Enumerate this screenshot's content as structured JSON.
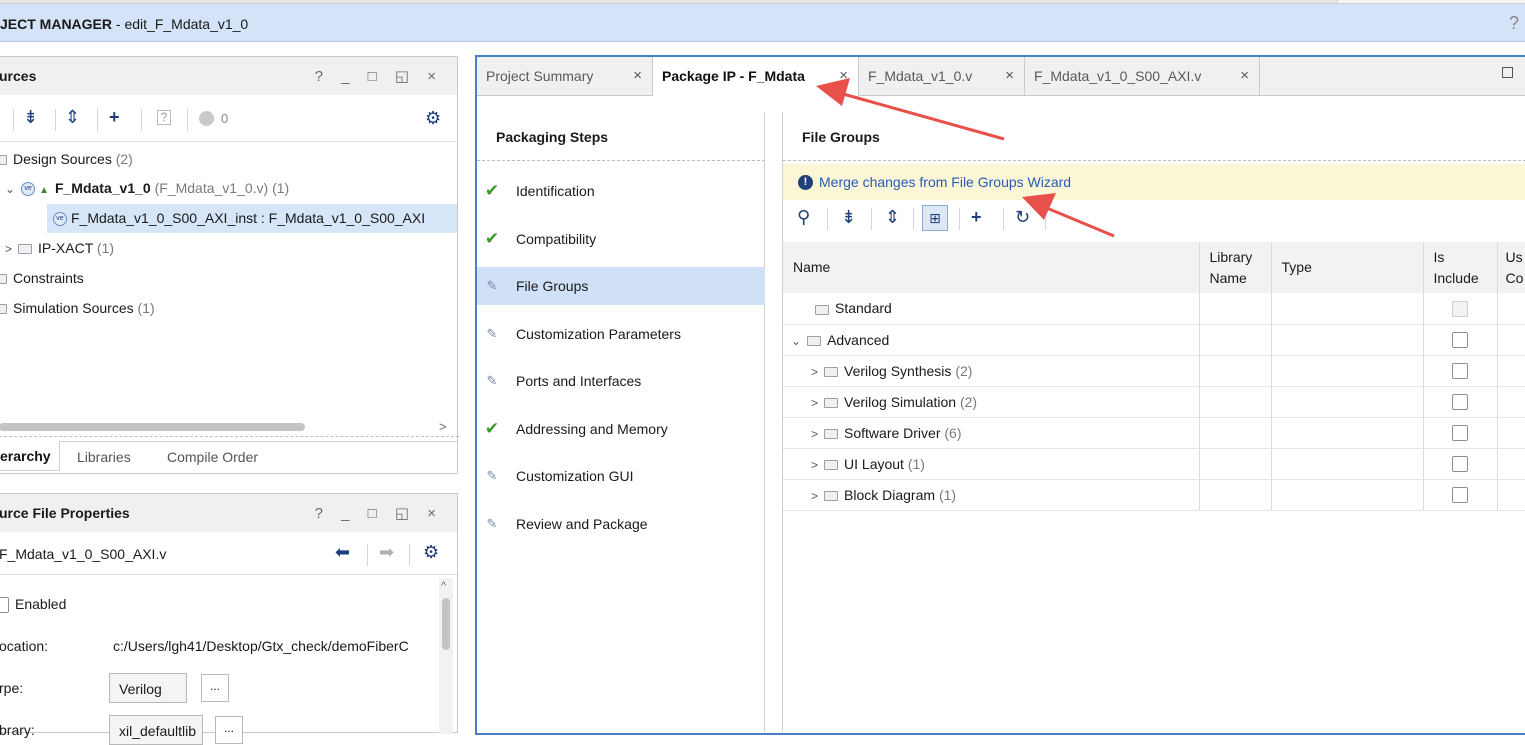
{
  "header": {
    "title_bold": "JECT MANAGER",
    "title_rest": " - edit_F_Mdata_v1_0",
    "help": "?"
  },
  "sources_panel": {
    "title": "urces",
    "controls": "? _ □ ◱ ×",
    "badge_count": "0",
    "tree": [
      {
        "label": "Design Sources",
        "count": "(2)"
      },
      {
        "label": "F_Mdata_v1_0",
        "detail": "(F_Mdata_v1_0.v)",
        "count": "(1)"
      },
      {
        "label": "F_Mdata_v1_0_S00_AXI_inst : F_Mdata_v1_0_S00_AXI"
      },
      {
        "label": "IP-XACT",
        "count": "(1)"
      },
      {
        "label": "Constraints"
      },
      {
        "label": "Simulation Sources",
        "count": "(1)"
      }
    ],
    "tabs": [
      "erarchy",
      "Libraries",
      "Compile Order"
    ]
  },
  "properties_panel": {
    "title": "urce File Properties",
    "controls": "? _ □ ◱ ×",
    "file_name": "F_Mdata_v1_0_S00_AXI.v",
    "enabled_label": "Enabled",
    "location_label": "ocation:",
    "location_value": "c:/Users/lgh41/Desktop/Gtx_check/demoFiberC",
    "type_label": "rpe:",
    "type_value": "Verilog",
    "library_label": "brary:",
    "library_value": "xil_defaultlib",
    "dots": "..."
  },
  "main_tabs": [
    {
      "label": "Project Summary"
    },
    {
      "label": "Package IP - F_Mdata"
    },
    {
      "label": "F_Mdata_v1_0.v"
    },
    {
      "label": "F_Mdata_v1_0_S00_AXI.v"
    }
  ],
  "packaging": {
    "title": "Packaging Steps",
    "steps": [
      {
        "label": "Identification",
        "status": "done"
      },
      {
        "label": "Compatibility",
        "status": "done"
      },
      {
        "label": "File Groups",
        "status": "edit"
      },
      {
        "label": "Customization Parameters",
        "status": "edit"
      },
      {
        "label": "Ports and Interfaces",
        "status": "edit"
      },
      {
        "label": "Addressing and Memory",
        "status": "done"
      },
      {
        "label": "Customization GUI",
        "status": "edit"
      },
      {
        "label": "Review and Package",
        "status": "edit"
      }
    ]
  },
  "file_groups": {
    "title": "File Groups",
    "banner_link": "Merge changes from File Groups Wizard",
    "columns": {
      "name": "Name",
      "library_1": "Library",
      "library_2": "Name",
      "type": "Type",
      "include_1": "Is",
      "include_2": "Include",
      "user_1": "Us",
      "user_2": "Co"
    },
    "rows": [
      {
        "label": "Standard",
        "count": ""
      },
      {
        "label": "Advanced",
        "count": ""
      },
      {
        "label": "Verilog Synthesis",
        "count": "(2)"
      },
      {
        "label": "Verilog Simulation",
        "count": "(2)"
      },
      {
        "label": "Software Driver",
        "count": "(6)"
      },
      {
        "label": "UI Layout",
        "count": "(1)"
      },
      {
        "label": "Block Diagram",
        "count": "(1)"
      }
    ]
  },
  "colors": {
    "project_bar": "#d4e3f7",
    "selected_step": "#cfe0f7",
    "banner": "#fbf6d5",
    "annotation_arrow": "#e8504a"
  }
}
